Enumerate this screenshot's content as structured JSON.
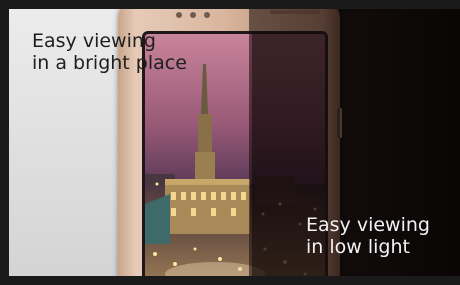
{
  "labels": {
    "bright_line1": "Easy viewing",
    "bright_line2": "in a bright place",
    "dark_line1": "Easy viewing",
    "dark_line2": "in low light"
  },
  "colors": {
    "bright_text": "#1f1f1f",
    "dark_text": "#f2f2f2",
    "phone_body": "#d8b49c",
    "sky_top": "#c8849a",
    "sky_bottom": "#4a2f48"
  },
  "image": {
    "subject": "phone-with-city-night-screen"
  }
}
